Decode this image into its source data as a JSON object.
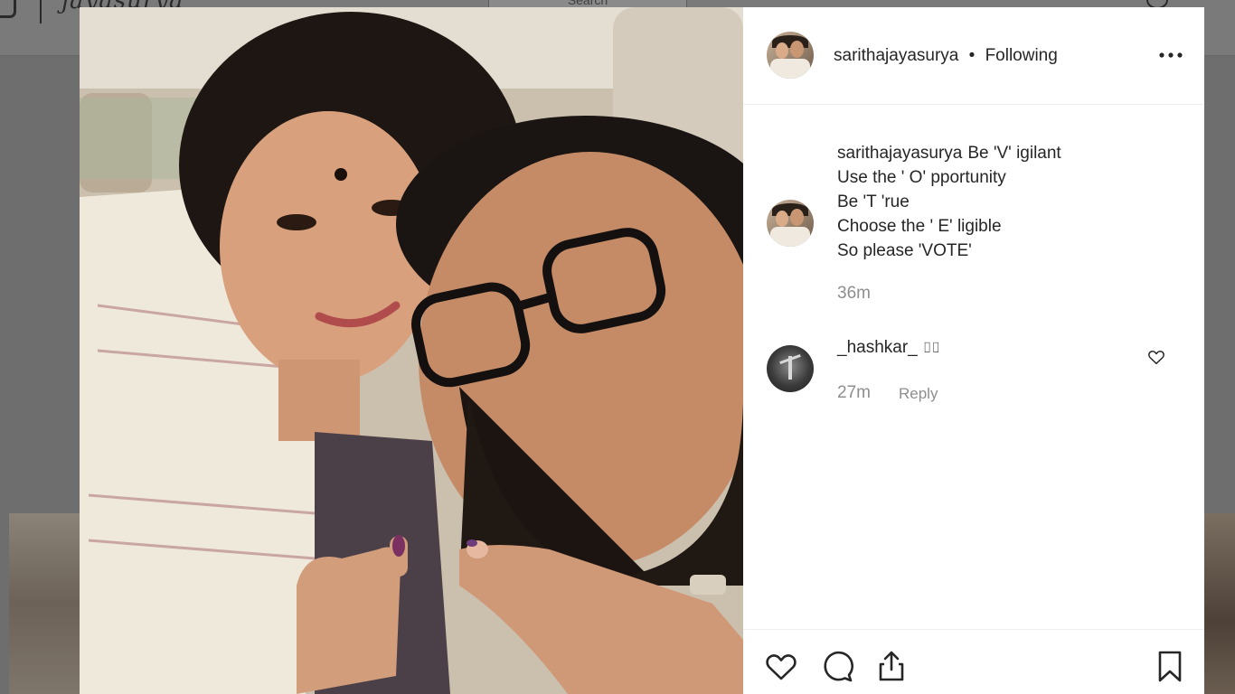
{
  "background_page": {
    "wordmark": "jayasurya",
    "search_placeholder": "Search"
  },
  "post": {
    "author": "sarithajayasurya",
    "separator": "•",
    "follow_status": "Following",
    "more_icon": "more-options-icon",
    "caption": {
      "username": "sarithajayasurya",
      "lines": [
        "Be 'V' igilant",
        "Use the ' O' pportunity",
        "Be 'T 'rue",
        "Choose the ' E' ligible",
        "So please 'VOTE'"
      ],
      "time": "36m"
    },
    "comments": [
      {
        "username": "_hashkar_",
        "text": "⌷⌷",
        "time": "27m",
        "reply_label": "Reply"
      }
    ],
    "actions": {
      "like_icon": "heart-icon",
      "comment_icon": "comment-bubble-icon",
      "share_icon": "share-icon",
      "save_icon": "bookmark-icon"
    }
  },
  "colors": {
    "overlay": "#6e6e6e",
    "text_primary": "#262626",
    "text_secondary": "#8e8e8e",
    "divider": "#efefef"
  }
}
